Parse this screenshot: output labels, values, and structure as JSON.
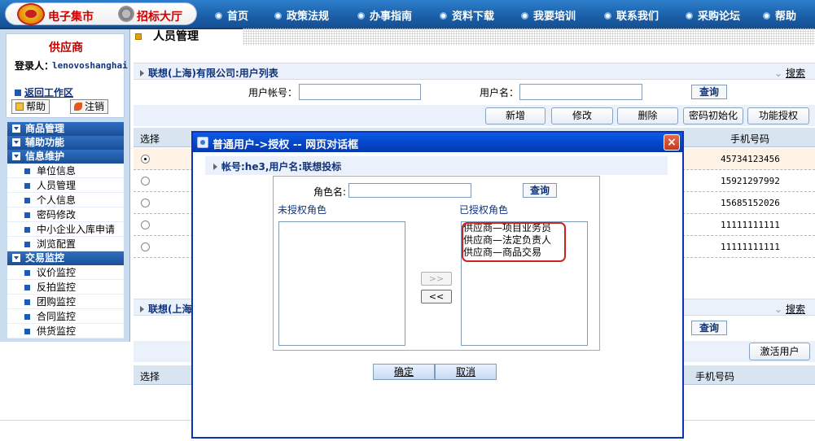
{
  "header": {
    "logo_text": "电子集市",
    "bid_hall": "招标大厅",
    "nav": [
      "首页",
      "政策法规",
      "办事指南",
      "资料下载",
      "我要培训",
      "联系我们",
      "采购论坛",
      "帮助"
    ]
  },
  "sidebar": {
    "title": "供应商",
    "login_label": "登录人：",
    "login_name": "lenovoshanghai",
    "back_link": "返回工作区",
    "help_btn": "帮助",
    "logout_btn": "注销",
    "menus": [
      {
        "label": "商品管理",
        "items": []
      },
      {
        "label": "辅助功能",
        "items": []
      },
      {
        "label": "信息维护",
        "items": [
          "单位信息",
          "人员管理",
          "个人信息",
          "密码修改",
          "中小企业入库申请",
          "浏览配置"
        ]
      },
      {
        "label": "交易监控",
        "items": [
          "议价监控",
          "反拍监控",
          "团购监控",
          "合同监控",
          "供货监控"
        ]
      }
    ]
  },
  "main": {
    "page_title": "人员管理",
    "section1_title": "联想(上海)有限公司:用户列表",
    "search_link": "搜索",
    "account_label": "用户帐号：",
    "username_label": "用户名：",
    "query_btn": "查询",
    "actions": [
      "新增",
      "修改",
      "删除",
      "密码初始化",
      "功能授权"
    ],
    "col_select": "选择",
    "col_phone": "手机号码",
    "rows": [
      {
        "phone": "45734123456",
        "selected": true
      },
      {
        "phone": "15921297992",
        "selected": false
      },
      {
        "phone": "15685152026",
        "selected": false
      },
      {
        "phone": "11111111111",
        "selected": false
      },
      {
        "phone": "11111111111",
        "selected": false
      }
    ],
    "section2_title": "联想(上海",
    "search_link2": "搜索",
    "query_btn2": "查询",
    "activate_btn": "激活用户",
    "col_select2": "选择",
    "col_phone2": "手机号码"
  },
  "dialog": {
    "title": "普通用户->授权  -- 网页对话框",
    "close": "×",
    "account_info": "帐号:he3,用户名:联想投标",
    "role_label": "角色名:",
    "role_value": "",
    "query_btn": "查询",
    "unauthorized_label": "未授权角色",
    "authorized_label": "已授权角色",
    "unauthorized_roles": [],
    "authorized_roles": [
      "供应商—项目业务员",
      "供应商—法定负责人",
      "供应商—商品交易"
    ],
    "move_right": ">>",
    "move_left": "<<",
    "ok_btn": "确定",
    "cancel_btn": "取消"
  },
  "colors": {
    "nav_blue": "#1a5fa8",
    "dialog_title_blue": "#0646c8",
    "brand_red": "#d00000",
    "highlight_red": "#d02020"
  }
}
